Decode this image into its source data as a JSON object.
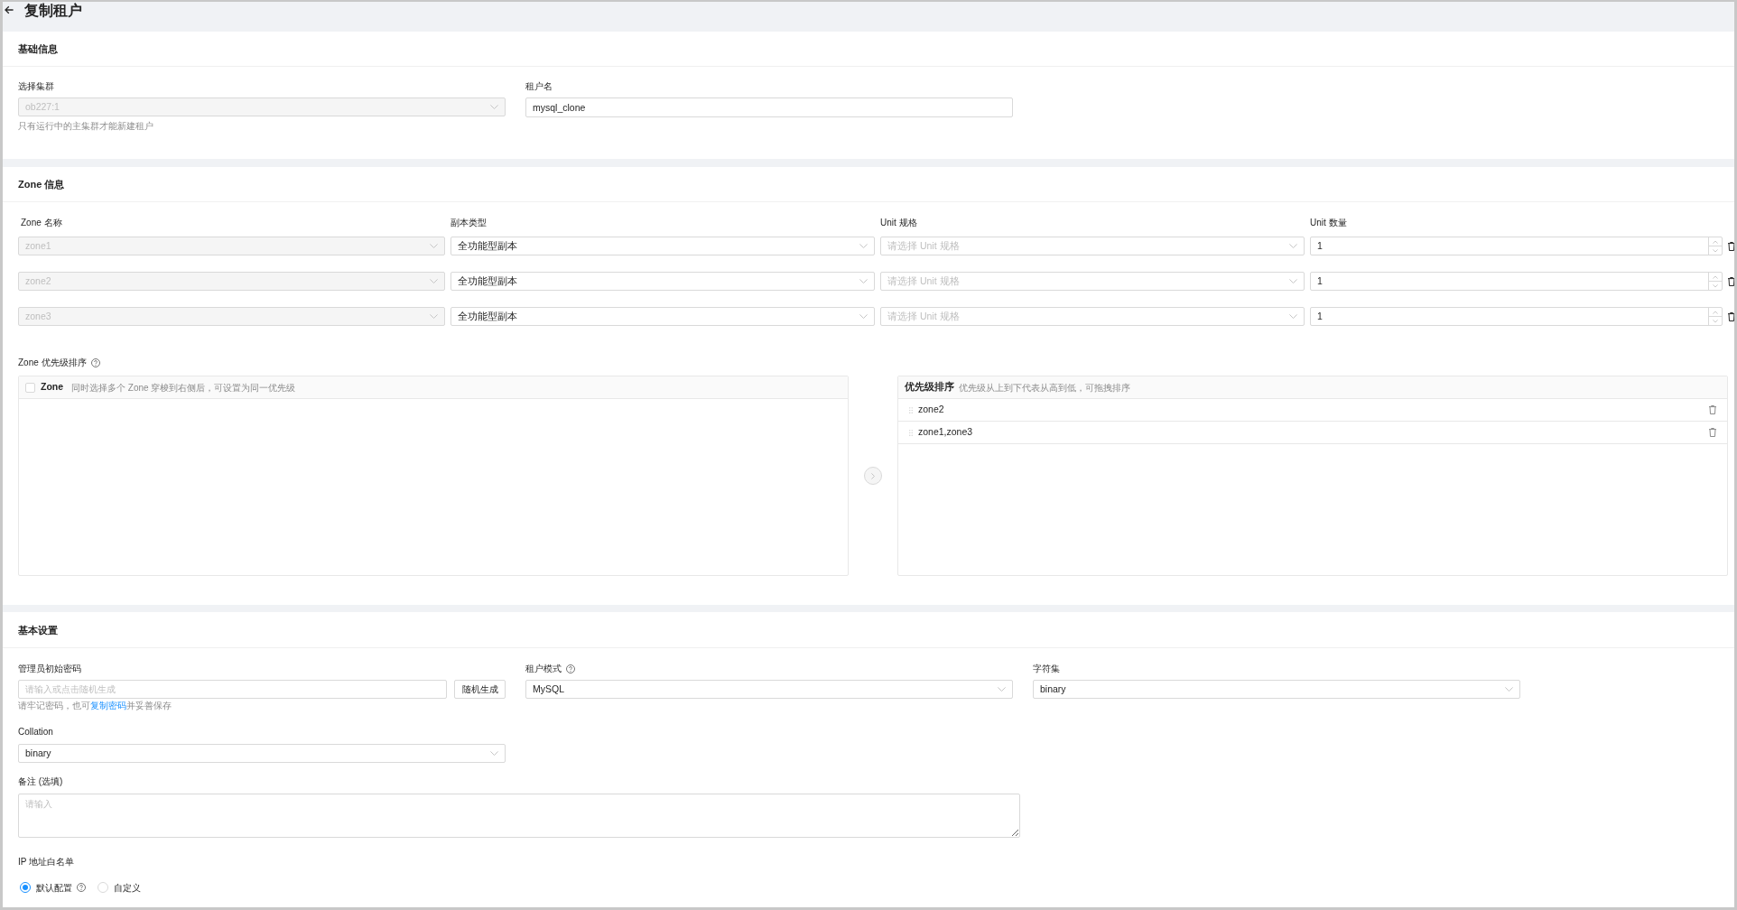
{
  "header": {
    "title": "复制租户"
  },
  "basic_info": {
    "title": "基础信息",
    "cluster": {
      "label": "选择集群",
      "value": "ob227:1",
      "disabled": true,
      "hint": "只有运行中的主集群才能新建租户"
    },
    "tenant_name": {
      "label": "租户名",
      "value": "mysql_clone"
    }
  },
  "zone_info": {
    "title": "Zone 信息",
    "columns": [
      "Zone 名称",
      "副本类型",
      "Unit 规格",
      "Unit 数量"
    ],
    "rows": [
      {
        "zone": "zone1",
        "zone_disabled": true,
        "replica_type": "全功能型副本",
        "unit_spec_placeholder": "请选择 Unit 规格",
        "unit_count": "1"
      },
      {
        "zone": "zone2",
        "zone_disabled": true,
        "replica_type": "全功能型副本",
        "unit_spec_placeholder": "请选择 Unit 规格",
        "unit_count": "1"
      },
      {
        "zone": "zone3",
        "zone_disabled": true,
        "replica_type": "全功能型副本",
        "unit_spec_placeholder": "请选择 Unit 规格",
        "unit_count": "1"
      }
    ],
    "priority": {
      "label": "Zone 优先级排序",
      "help": true,
      "source": {
        "title": "Zone",
        "hint": "同时选择多个 Zone 穿梭到右侧后，可设置为同一优先级",
        "checked": false
      },
      "transfer_disabled": true,
      "target": {
        "title": "优先级排序",
        "hint": "优先级从上到下代表从高到低，可拖拽排序",
        "items": [
          "zone2",
          "zone1,zone3"
        ]
      }
    }
  },
  "basic_settings": {
    "title": "基本设置",
    "password": {
      "label": "管理员初始密码",
      "placeholder": "请输入或点击随机生成",
      "button": "随机生成",
      "hint_before": "请牢记密码，也可",
      "hint_link": "复制密码",
      "hint_after": "并妥善保存"
    },
    "tenant_mode": {
      "label": "租户模式",
      "help": true,
      "value": "MySQL"
    },
    "charset": {
      "label": "字符集",
      "value": "binary"
    },
    "collation": {
      "label": "Collation",
      "value": "binary"
    },
    "remark": {
      "label": "备注 (选填)",
      "placeholder": "请输入"
    },
    "ip_whitelist": {
      "label": "IP 地址白名单",
      "options": [
        {
          "label": "默认配置",
          "selected": true,
          "help": true
        },
        {
          "label": "自定义",
          "selected": false
        }
      ]
    }
  }
}
